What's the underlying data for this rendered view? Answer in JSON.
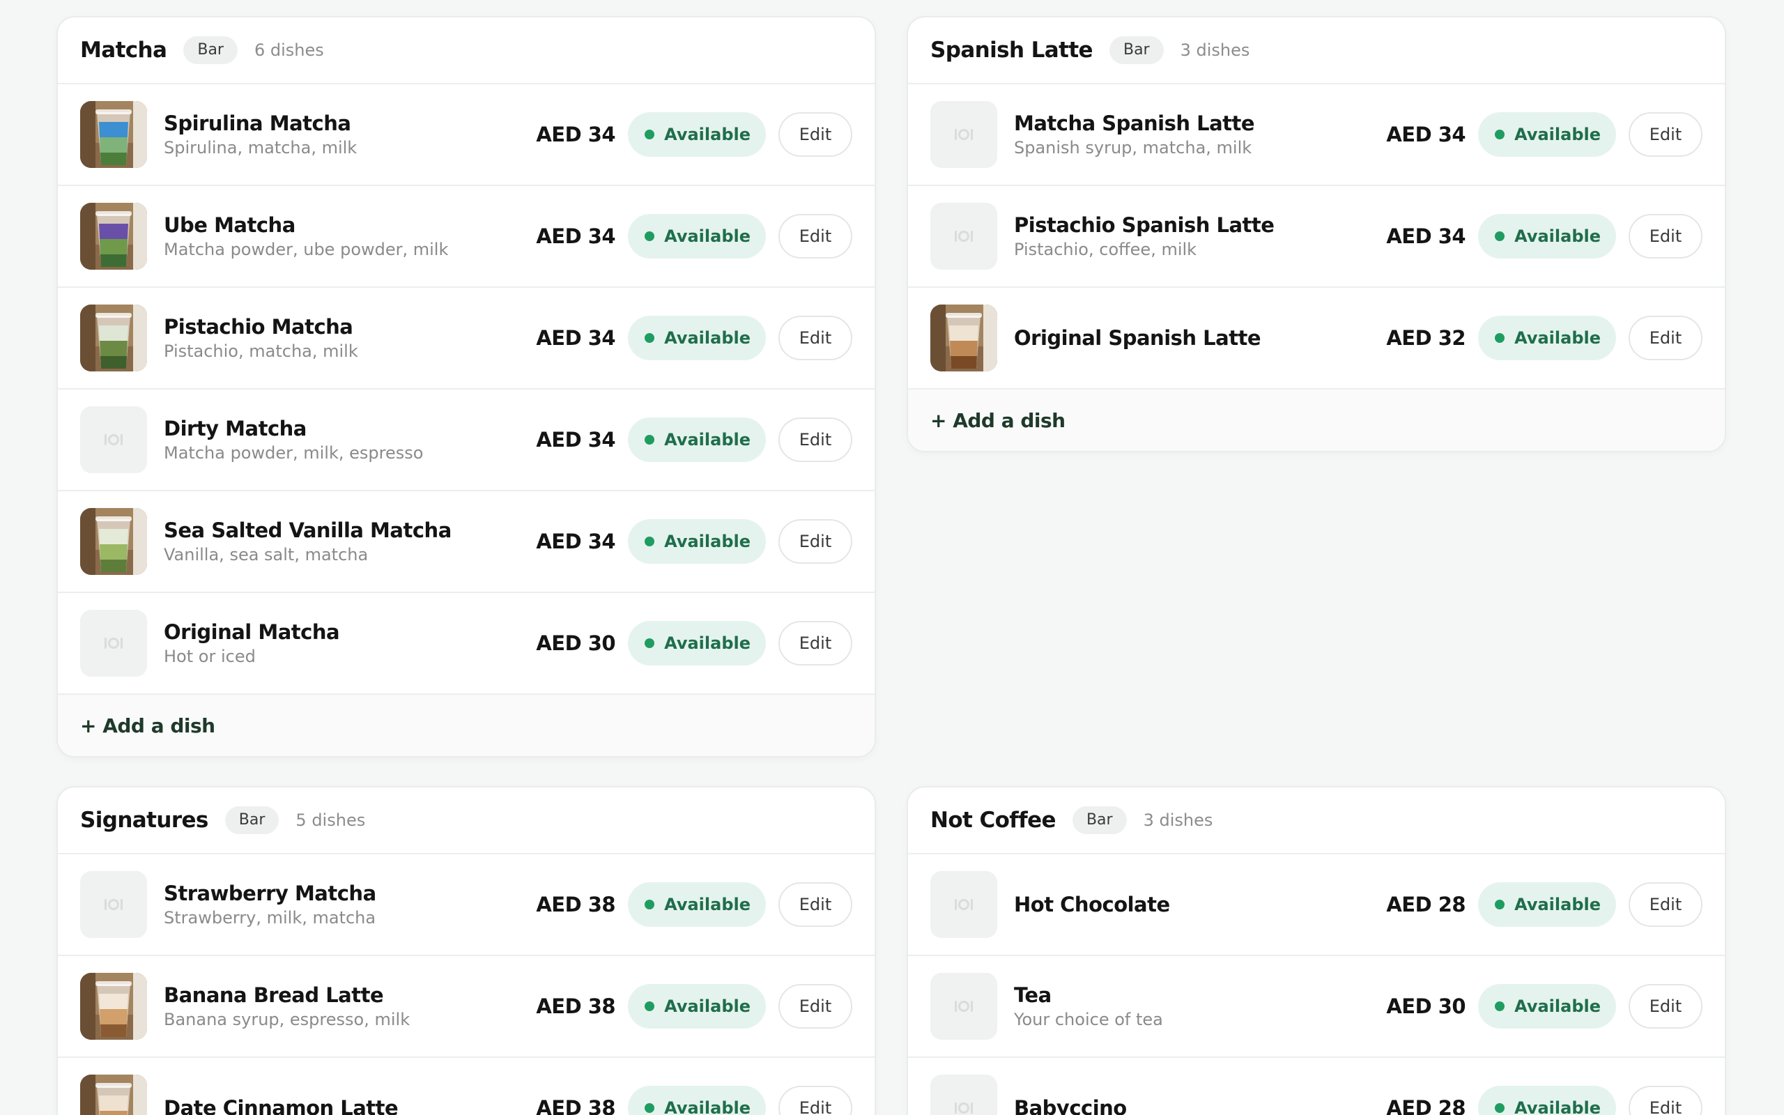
{
  "currency": "AED",
  "colors": {
    "accent": "#1f9d61",
    "status_bg": "#e5f3ee",
    "status_text": "#1f6e4b",
    "page_bg": "#f5f7f6"
  },
  "add_label": "+ Add a dish",
  "status_label": "Available",
  "edit_label": "Edit",
  "categories": [
    {
      "title": "Matcha",
      "station": "Bar",
      "count_label": "6 dishes",
      "dishes": [
        {
          "name": "Spirulina Matcha",
          "desc": "Spirulina, matcha, milk",
          "price": "AED 34",
          "photo": true,
          "photo_icon": "blue-green-matcha-cup-photo"
        },
        {
          "name": "Ube Matcha",
          "desc": "Matcha powder, ube powder, milk",
          "price": "AED 34",
          "photo": true,
          "photo_icon": "purple-green-matcha-cup-photo"
        },
        {
          "name": "Pistachio Matcha",
          "desc": "Pistachio, matcha, milk",
          "price": "AED 34",
          "photo": true,
          "photo_icon": "green-matcha-cup-photo"
        },
        {
          "name": "Dirty Matcha",
          "desc": "Matcha powder, milk, espresso",
          "price": "AED 34",
          "photo": false
        },
        {
          "name": "Sea Salted Vanilla Matcha",
          "desc": "Vanilla, sea salt, matcha",
          "price": "AED 34",
          "photo": true,
          "photo_icon": "light-green-matcha-cup-photo"
        },
        {
          "name": "Original Matcha",
          "desc": "Hot or iced",
          "price": "AED 30",
          "photo": false
        }
      ],
      "show_add": true
    },
    {
      "title": "Spanish Latte",
      "station": "Bar",
      "count_label": "3 dishes",
      "dishes": [
        {
          "name": "Matcha Spanish Latte",
          "desc": "Spanish syrup, matcha, milk",
          "price": "AED 34",
          "photo": false
        },
        {
          "name": "Pistachio Spanish Latte",
          "desc": "Pistachio, coffee, milk",
          "price": "AED 34",
          "photo": false
        },
        {
          "name": "Original Spanish Latte",
          "desc": "",
          "price": "AED 32",
          "photo": true,
          "photo_icon": "iced-latte-cup-photo"
        }
      ],
      "show_add": true
    },
    {
      "title": "Signatures",
      "station": "Bar",
      "count_label": "5 dishes",
      "dishes": [
        {
          "name": "Strawberry Matcha",
          "desc": "Strawberry, milk, matcha",
          "price": "AED 38",
          "photo": false
        },
        {
          "name": "Banana Bread Latte",
          "desc": "Banana syrup, espresso, milk",
          "price": "AED 38",
          "photo": true,
          "photo_icon": "caramel-latte-cup-photo"
        },
        {
          "name": "Date Cinnamon Latte",
          "desc": "",
          "price": "AED 38",
          "photo": true,
          "photo_icon": "cinnamon-latte-cup-photo"
        }
      ],
      "show_add": false
    },
    {
      "title": "Not Coffee",
      "station": "Bar",
      "count_label": "3 dishes",
      "dishes": [
        {
          "name": "Hot Chocolate",
          "desc": "",
          "price": "AED 28",
          "photo": false
        },
        {
          "name": "Tea",
          "desc": "Your choice of tea",
          "price": "AED 30",
          "photo": false
        },
        {
          "name": "Babyccino",
          "desc": "",
          "price": "AED 28",
          "photo": false
        }
      ],
      "show_add": false
    }
  ]
}
